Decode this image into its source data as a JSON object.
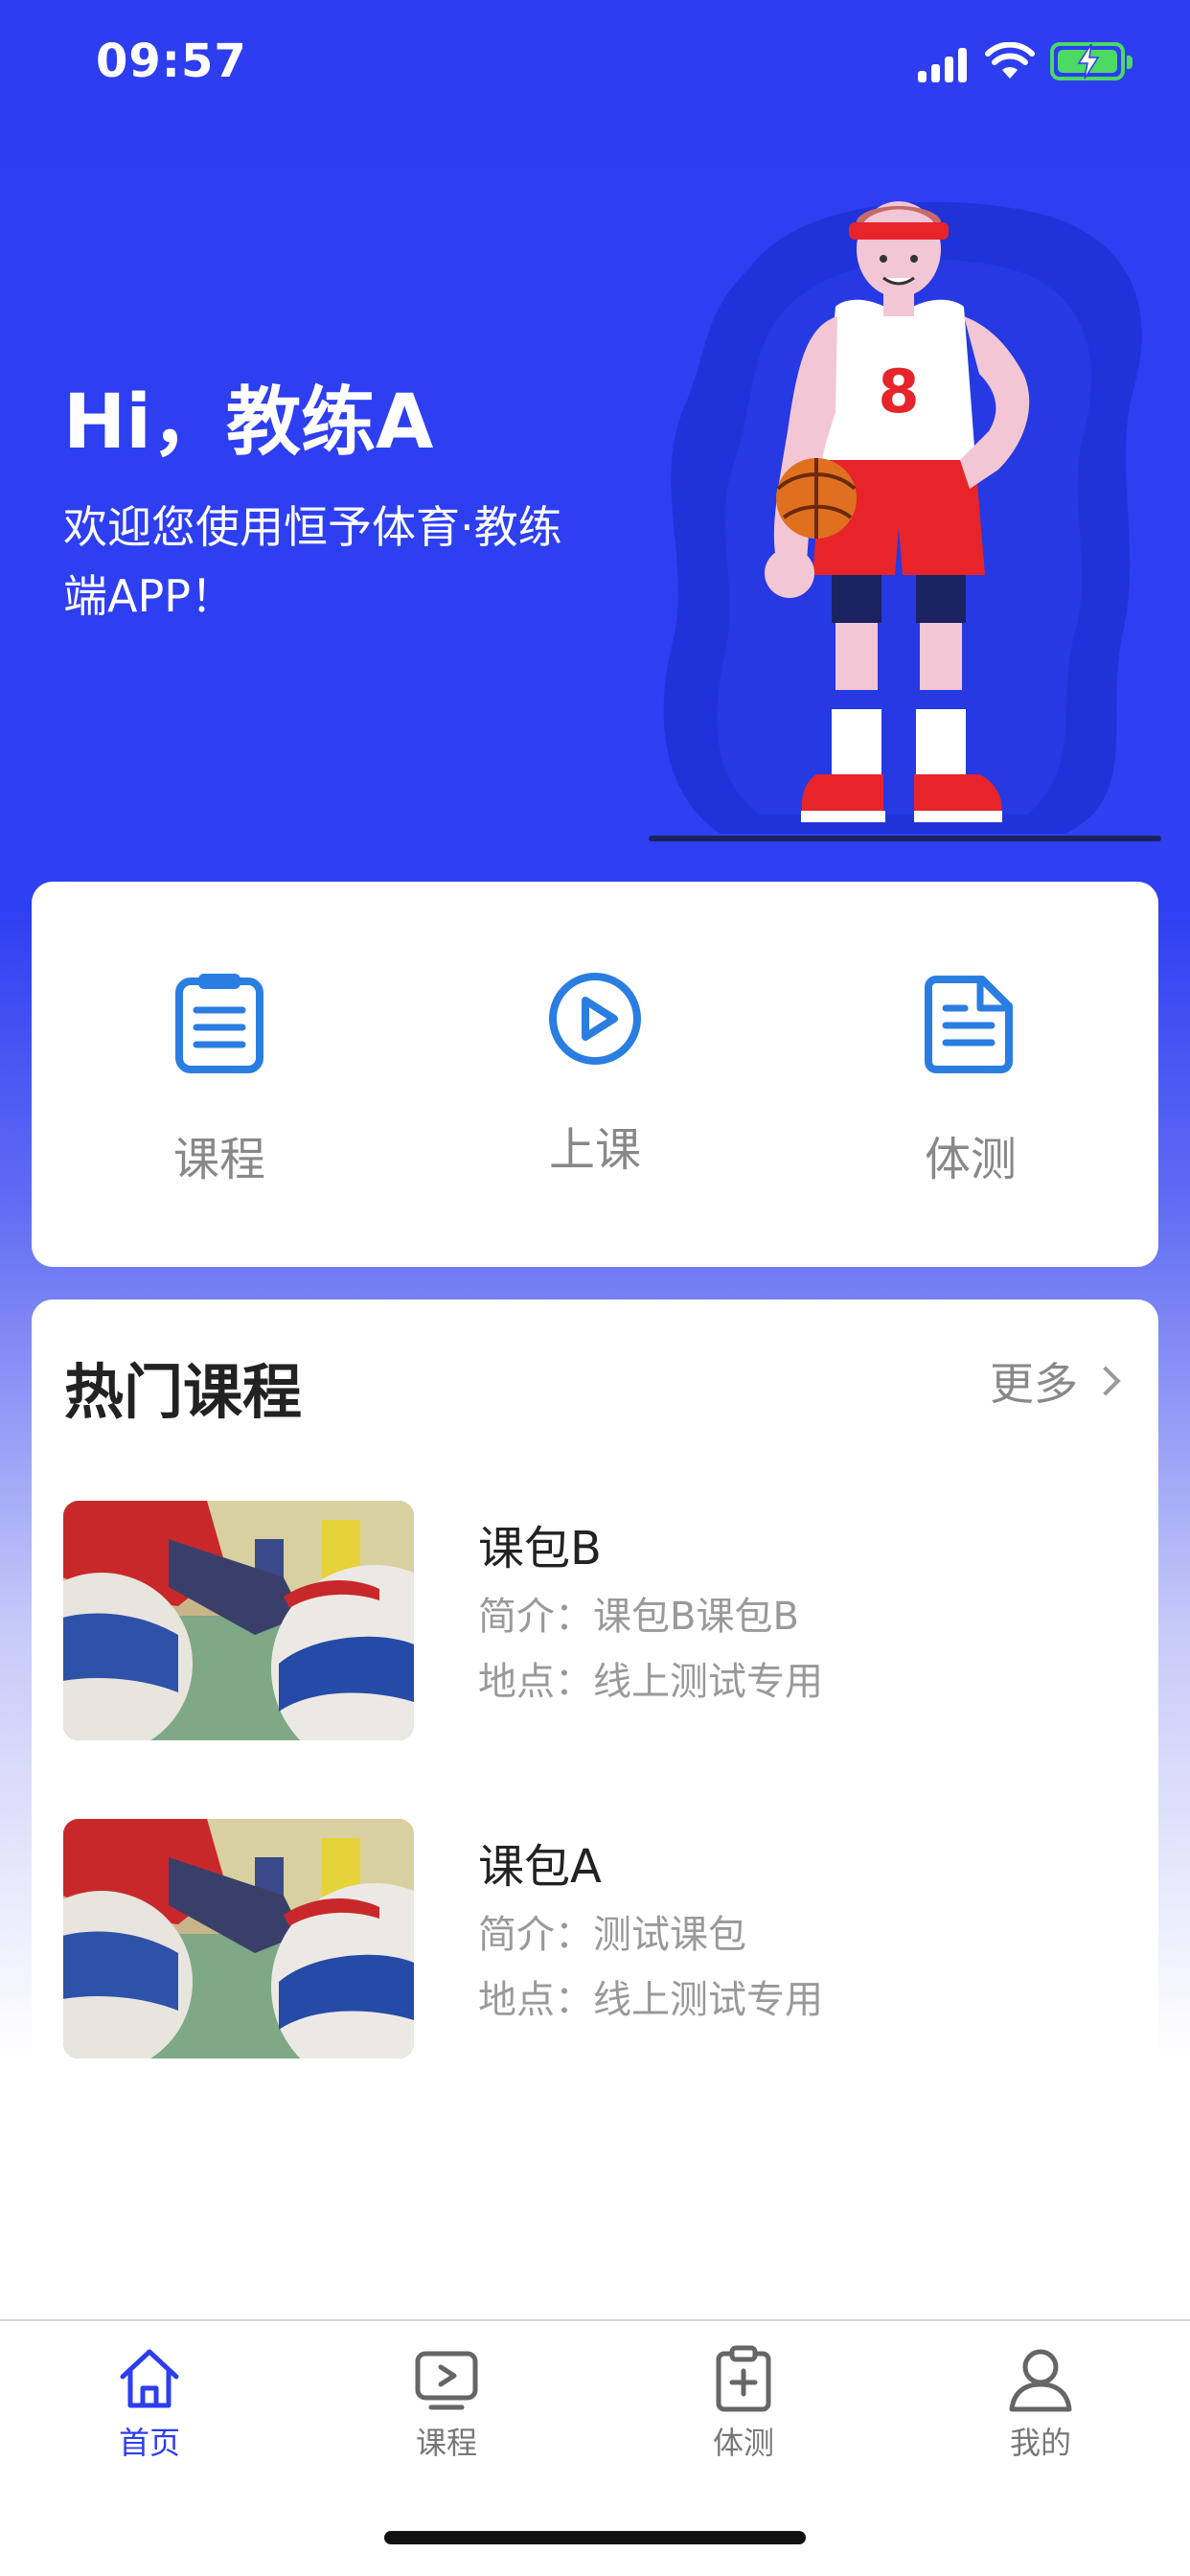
{
  "status_bar": {
    "time": "09:57"
  },
  "hero": {
    "greeting": "Hi，教练A",
    "welcome_line1": "欢迎您使用恒予体育·教练",
    "welcome_line2": "端APP！",
    "jersey_number": "8"
  },
  "quick_actions": [
    {
      "label": "课程",
      "icon": "list-document-icon"
    },
    {
      "label": "上课",
      "icon": "play-circle-icon"
    },
    {
      "label": "体测",
      "icon": "file-text-icon"
    }
  ],
  "hot_courses": {
    "title": "热门课程",
    "more_label": "更多",
    "items": [
      {
        "name": "课包B",
        "intro": "简介：课包B课包B",
        "location": "地点：线上测试专用"
      },
      {
        "name": "课包A",
        "intro": "简介：测试课包",
        "location": "地点：线上测试专用"
      }
    ]
  },
  "tab_bar": {
    "active": "首页",
    "tabs": [
      {
        "label": "首页",
        "icon": "home-icon"
      },
      {
        "label": "课程",
        "icon": "video-play-icon"
      },
      {
        "label": "体测",
        "icon": "clipboard-plus-icon"
      },
      {
        "label": "我的",
        "icon": "user-icon"
      }
    ]
  },
  "colors": {
    "primary": "#2d3df0",
    "accent_blue": "#2a7de1",
    "battery": "#4cd964",
    "jersey_red": "#e8242b"
  }
}
